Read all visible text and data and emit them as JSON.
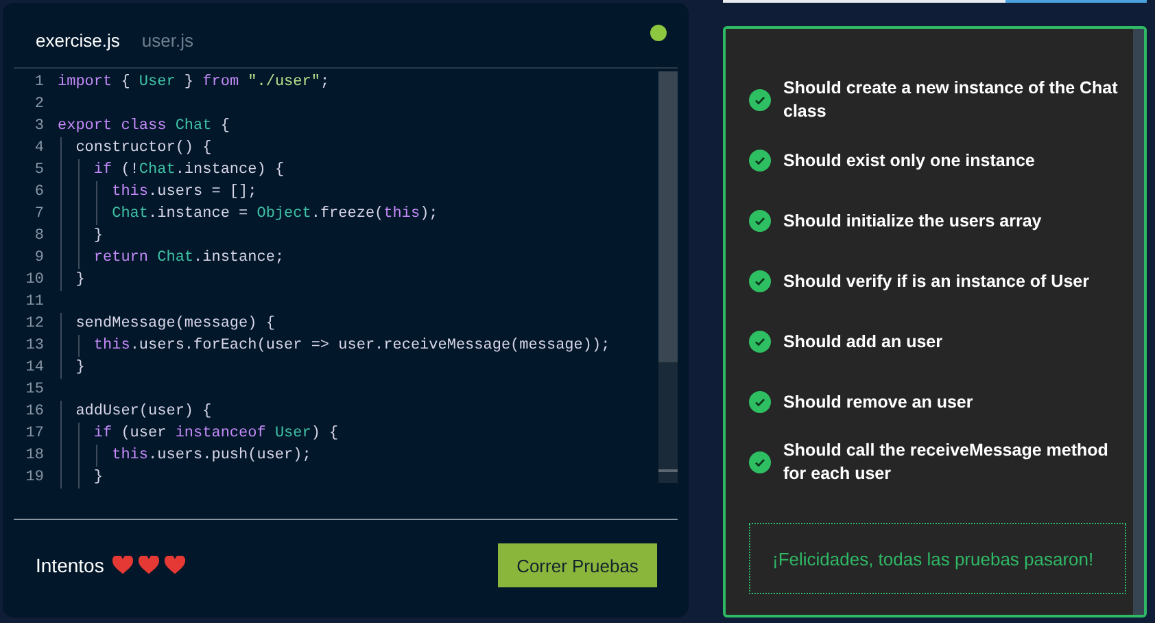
{
  "editor": {
    "tabs": [
      {
        "label": "exercise.js",
        "selected": true
      },
      {
        "label": "user.js",
        "selected": false
      }
    ],
    "status_dot": {
      "color": "#8dc63f"
    },
    "lines": [
      {
        "number": "1",
        "tokens": [
          {
            "t": "import",
            "color": "#c58af9"
          },
          {
            "t": " { ",
            "color": "#d8d6e8"
          },
          {
            "t": "User",
            "color": "#3fc1a5"
          },
          {
            "t": " } ",
            "color": "#d8d6e8"
          },
          {
            "t": "from",
            "color": "#c58af9"
          },
          {
            "t": " \"./user\"",
            "color": "#b5e08a"
          },
          {
            "t": ";",
            "color": "#d8d6e8"
          }
        ]
      },
      {
        "number": "2"
      },
      {
        "number": "3",
        "tokens": [
          {
            "t": "export class ",
            "color": "#c58af9"
          },
          {
            "t": "Chat",
            "color": "#3fc1a5"
          },
          {
            "t": " {",
            "color": "#d8d6e8"
          }
        ]
      },
      {
        "number": "4",
        "tokens": [
          {
            "t": "  constructor() {",
            "color": "#d8d6e8"
          }
        ]
      },
      {
        "number": "5",
        "tokens": [
          {
            "t": "    if",
            "color": "#c58af9"
          },
          {
            "t": " (!",
            "color": "#d8d6e8"
          },
          {
            "t": "Chat",
            "color": "#3fc1a5"
          },
          {
            "t": ".instance) {",
            "color": "#d8d6e8"
          }
        ]
      },
      {
        "number": "6",
        "tokens": [
          {
            "t": "      this",
            "color": "#c58af9"
          },
          {
            "t": ".users = [];",
            "color": "#d8d6e8"
          }
        ]
      },
      {
        "number": "7",
        "tokens": [
          {
            "t": "      Chat",
            "color": "#3fc1a5"
          },
          {
            "t": ".instance = ",
            "color": "#d8d6e8"
          },
          {
            "t": "Object",
            "color": "#3fc1a5"
          },
          {
            "t": ".freeze(",
            "color": "#d8d6e8"
          },
          {
            "t": "this",
            "color": "#c58af9"
          },
          {
            "t": ");",
            "color": "#d8d6e8"
          }
        ]
      },
      {
        "number": "8",
        "tokens": [
          {
            "t": "    }",
            "color": "#d8d6e8"
          }
        ]
      },
      {
        "number": "9",
        "tokens": [
          {
            "t": "    return ",
            "color": "#c58af9"
          },
          {
            "t": "Chat",
            "color": "#3fc1a5"
          },
          {
            "t": ".instance;",
            "color": "#d8d6e8"
          }
        ]
      },
      {
        "number": "10",
        "tokens": [
          {
            "t": "  }",
            "color": "#d8d6e8"
          }
        ]
      },
      {
        "number": "11"
      },
      {
        "number": "12",
        "tokens": [
          {
            "t": "  sendMessage(message) {",
            "color": "#d8d6e8"
          }
        ]
      },
      {
        "number": "13",
        "tokens": [
          {
            "t": "    this",
            "color": "#c58af9"
          },
          {
            "t": ".users.forEach(user => user.receiveMessage(message));",
            "color": "#d8d6e8"
          }
        ]
      },
      {
        "number": "14",
        "tokens": [
          {
            "t": "  }",
            "color": "#d8d6e8"
          }
        ]
      },
      {
        "number": "15"
      },
      {
        "number": "16",
        "tokens": [
          {
            "t": "  addUser(user) {",
            "color": "#d8d6e8"
          }
        ]
      },
      {
        "number": "17",
        "tokens": [
          {
            "t": "    if",
            "color": "#c58af9"
          },
          {
            "t": " (user ",
            "color": "#d8d6e8"
          },
          {
            "t": "instanceof",
            "color": "#c58af9"
          },
          {
            "t": " User",
            "color": "#3fc1a5"
          },
          {
            "t": ") {",
            "color": "#d8d6e8"
          }
        ]
      },
      {
        "number": "18",
        "tokens": [
          {
            "t": "      this",
            "color": "#c58af9"
          },
          {
            "t": ".users.push(user);",
            "color": "#d8d6e8"
          }
        ]
      },
      {
        "number": "19",
        "tokens": [
          {
            "t": "    }",
            "color": "#d8d6e8"
          }
        ]
      }
    ]
  },
  "attempts": {
    "label": "Intentos",
    "stars": 3
  },
  "run_button": "Correr Pruebas",
  "tests": [
    {
      "label": "Should create a new instance of the Chat class",
      "passed": true
    },
    {
      "label": "Should exist only one instance",
      "passed": true
    },
    {
      "label": "Should initialize the users array",
      "passed": true
    },
    {
      "label": "Should verify if is an instance of User",
      "passed": true
    },
    {
      "label": "Should add an user",
      "passed": true
    },
    {
      "label": "Should remove an user",
      "passed": true
    },
    {
      "label": "Should call the receiveMessage method for each user",
      "passed": true
    }
  ],
  "result_message": "¡Felicidades, todas las pruebas pasaron!"
}
